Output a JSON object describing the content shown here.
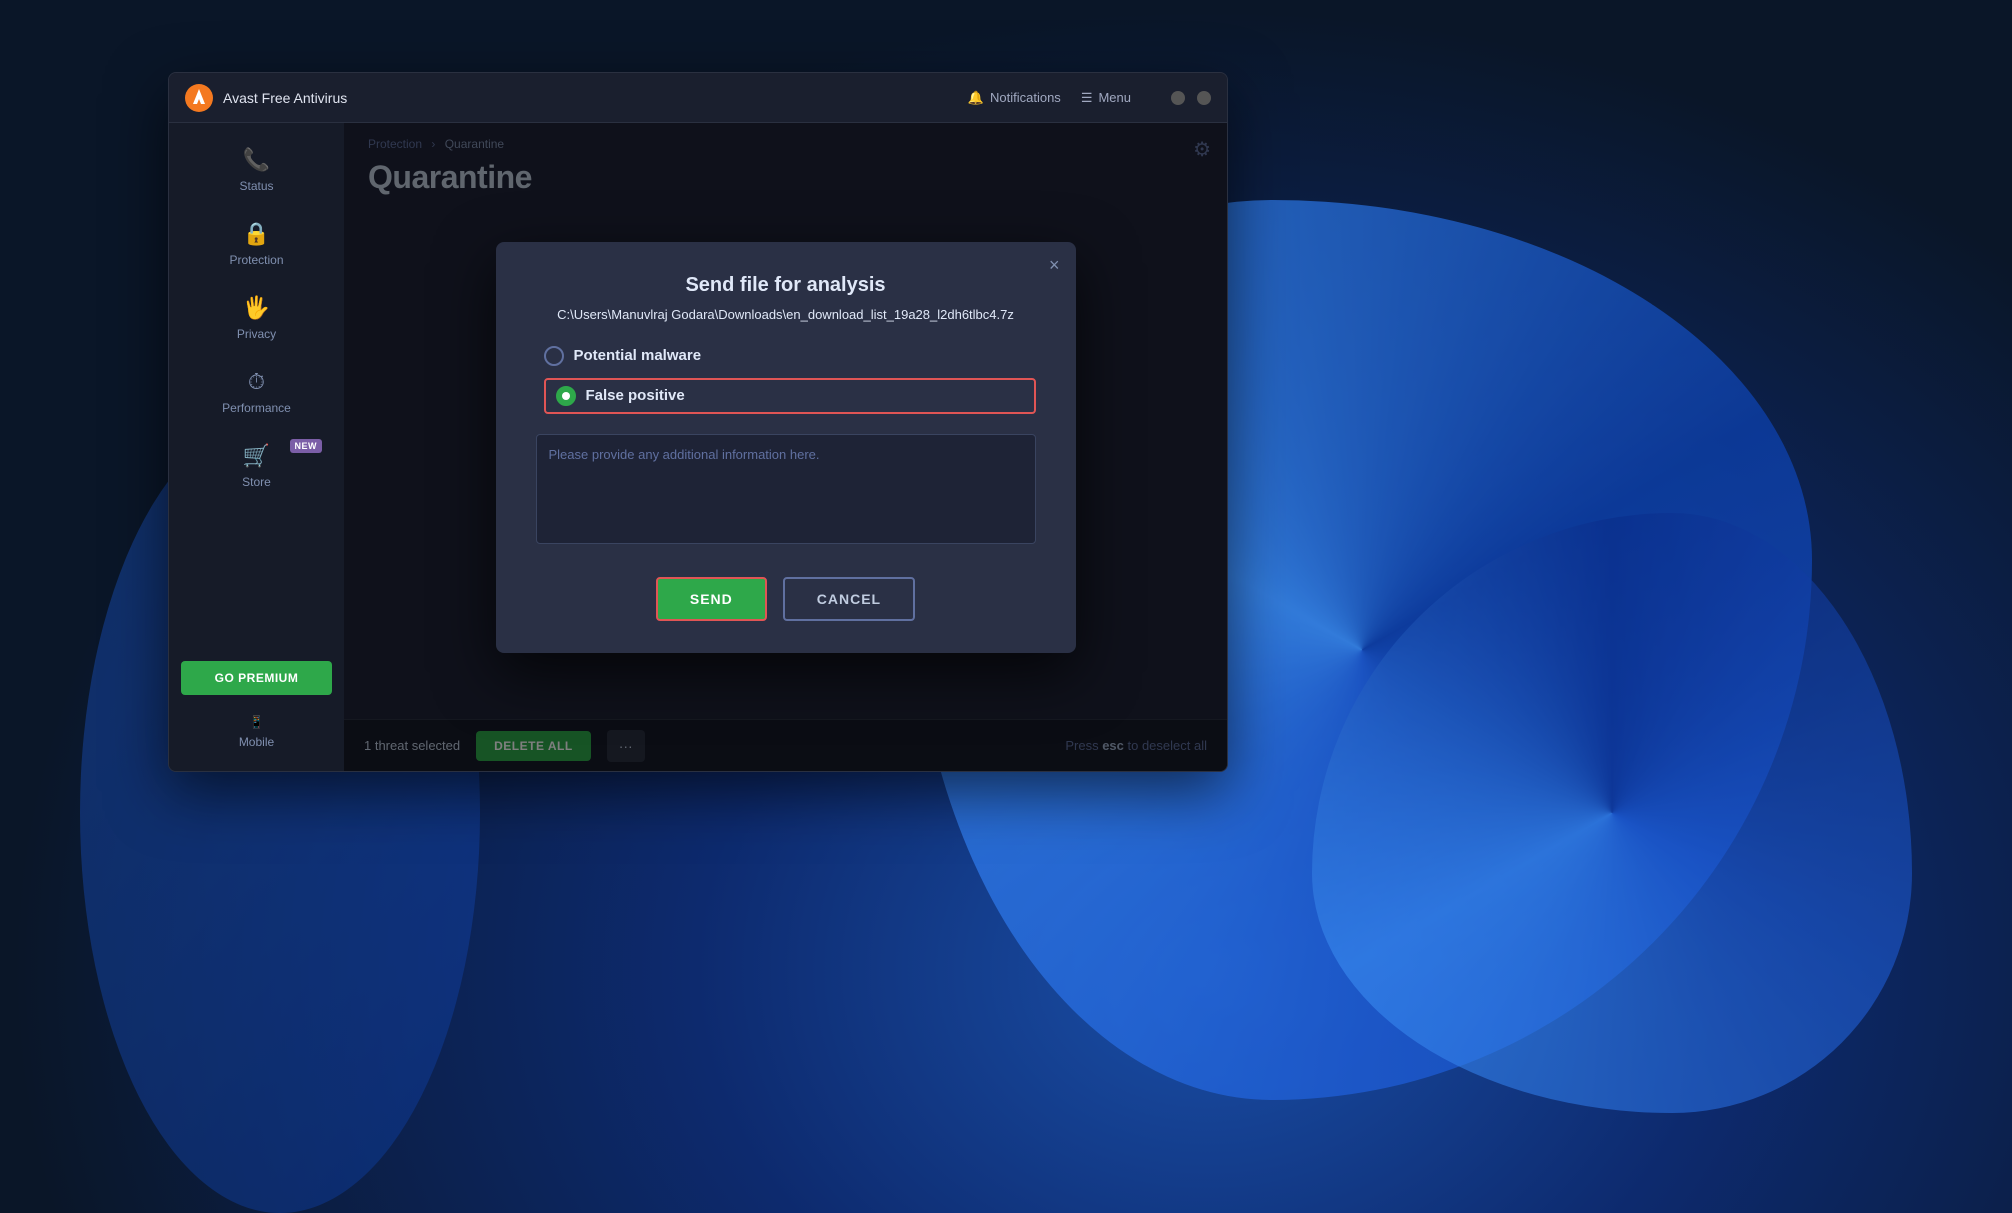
{
  "window": {
    "title": "Avast Free Antivirus",
    "bg_color": "#1a1f2e"
  },
  "titlebar": {
    "app_name": "Avast Free Antivirus",
    "notifications_label": "Notifications",
    "menu_label": "Menu"
  },
  "sidebar": {
    "items": [
      {
        "id": "status",
        "label": "Status",
        "icon": "📞"
      },
      {
        "id": "protection",
        "label": "Protection",
        "icon": "🔒"
      },
      {
        "id": "privacy",
        "label": "Privacy",
        "icon": "🖐"
      },
      {
        "id": "performance",
        "label": "Performance",
        "icon": "⏱"
      },
      {
        "id": "store",
        "label": "Store",
        "icon": "🛒",
        "badge": "NEW"
      }
    ],
    "go_premium_label": "GO PREMIUM",
    "mobile_label": "Mobile",
    "mobile_icon": "📱"
  },
  "breadcrumb": {
    "parent": "Protection",
    "separator": "›",
    "current": "Quarantine"
  },
  "page": {
    "title": "Quarantine",
    "settings_icon": "⚙"
  },
  "status_bar": {
    "selected_text": "1 threat selected",
    "delete_all_label": "DELETE ALL",
    "more_label": "···",
    "press_esc_prefix": "Press ",
    "press_esc_key": "esc",
    "press_esc_suffix": " to deselect all"
  },
  "modal": {
    "title": "Send file for analysis",
    "filepath": "C:\\Users\\Manuvlraj Godara\\Downloads\\en_download_list_19a28_l2dh6tlbc4.7z",
    "close_icon": "×",
    "options": [
      {
        "id": "potential_malware",
        "label": "Potential malware",
        "selected": false
      },
      {
        "id": "false_positive",
        "label": "False positive",
        "selected": true
      }
    ],
    "textarea_placeholder": "Please provide any additional information here.",
    "textarea_value": "",
    "send_label": "SEND",
    "cancel_label": "CANCEL"
  }
}
